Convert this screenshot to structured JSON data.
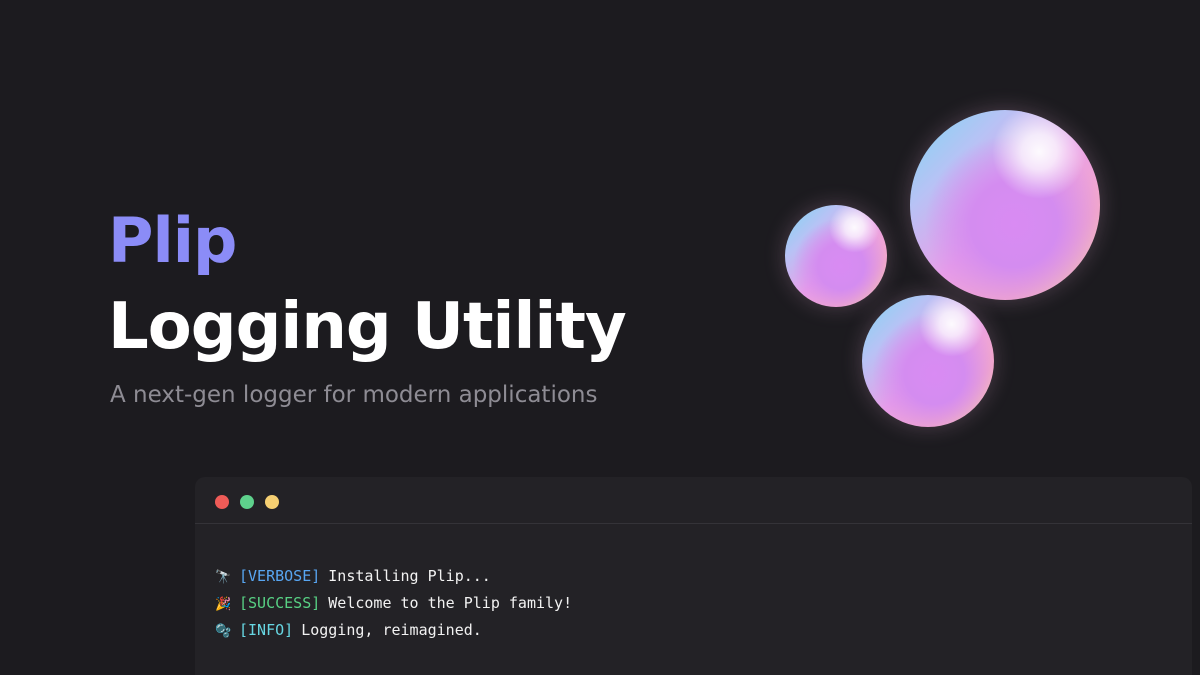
{
  "hero": {
    "brand": "Plip",
    "headline": "Logging Utility",
    "tagline": "A next-gen logger for modern applications"
  },
  "colors": {
    "background": "#1c1b1f",
    "brand": "#8b8cf7",
    "tagline": "#8e8c94",
    "terminal_bg": "#232226",
    "verbose": "#58a6f2",
    "success": "#58d184",
    "info": "#67d7e3"
  },
  "terminal": {
    "window_controls": [
      "close-dot",
      "minimize-dot",
      "maximize-dot"
    ],
    "lines": [
      {
        "icon": "🔭",
        "tag": "[VERBOSE]",
        "message": "Installing Plip..."
      },
      {
        "icon": "🎉",
        "tag": "[SUCCESS]",
        "message": "Welcome to the Plip family!"
      },
      {
        "icon": "🫧",
        "tag": "[INFO]",
        "message": "Logging, reimagined."
      }
    ]
  },
  "decorations": {
    "bubbles_icon": "bubbles-illustration"
  }
}
